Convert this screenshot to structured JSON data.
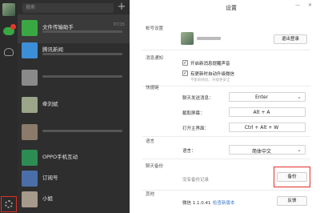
{
  "sidebar": {
    "icons": [
      "chat-icon",
      "contacts-icon",
      "settings-icon"
    ],
    "badge_color": "#e03a2e"
  },
  "chatlist": {
    "search_placeholder": "搜索",
    "add_label": "+",
    "conversations": [
      {
        "name": "文件传输助手",
        "time": "07/15",
        "color": "#3aa842"
      },
      {
        "name": "腾讯新闻",
        "time": "",
        "color": "#3c8ed6"
      },
      {
        "name": "",
        "time": "",
        "color": "#8a8a8a"
      },
      {
        "name": "牵刘斌",
        "time": "",
        "color": "#9aa58a"
      },
      {
        "name": "",
        "time": "",
        "color": "#8c7a6a"
      },
      {
        "name": "OPPO手机互动",
        "time": "",
        "color": "#2d8c54"
      },
      {
        "name": "订阅号",
        "time": "",
        "color": "#4a6fa8"
      },
      {
        "name": "小姐",
        "time": "",
        "color": "#a69a8a"
      }
    ]
  },
  "settings": {
    "title": "设置",
    "window_controls": "— ✕",
    "sections": {
      "account": "帐号设置",
      "notify": "消息通知",
      "shortcut": "快捷键",
      "language": "语言",
      "backup": "聊天备份",
      "other": "其他"
    },
    "logout_label": "退出登录",
    "options": {
      "sound": "开启新消息提醒声音",
      "auto_update": "有更新时自动升级微信",
      "auto_update_hint": "不影响体验，升级更安全"
    },
    "shortcuts": [
      {
        "label": "聊天发送消息：",
        "value": "Enter"
      },
      {
        "label": "截取屏幕：",
        "value": "Alt + A"
      },
      {
        "label": "打开主界面：",
        "value": "Ctrl + Alt + W"
      }
    ],
    "language": {
      "label": "语言：",
      "value": "简体中文"
    },
    "backup_status": "没有备份记录",
    "backup_button": "备份",
    "version": "微信 1.1.0.41",
    "check_update": "检查新版本",
    "feedback_button": "反馈",
    "highlight_color": "#e0302a"
  }
}
